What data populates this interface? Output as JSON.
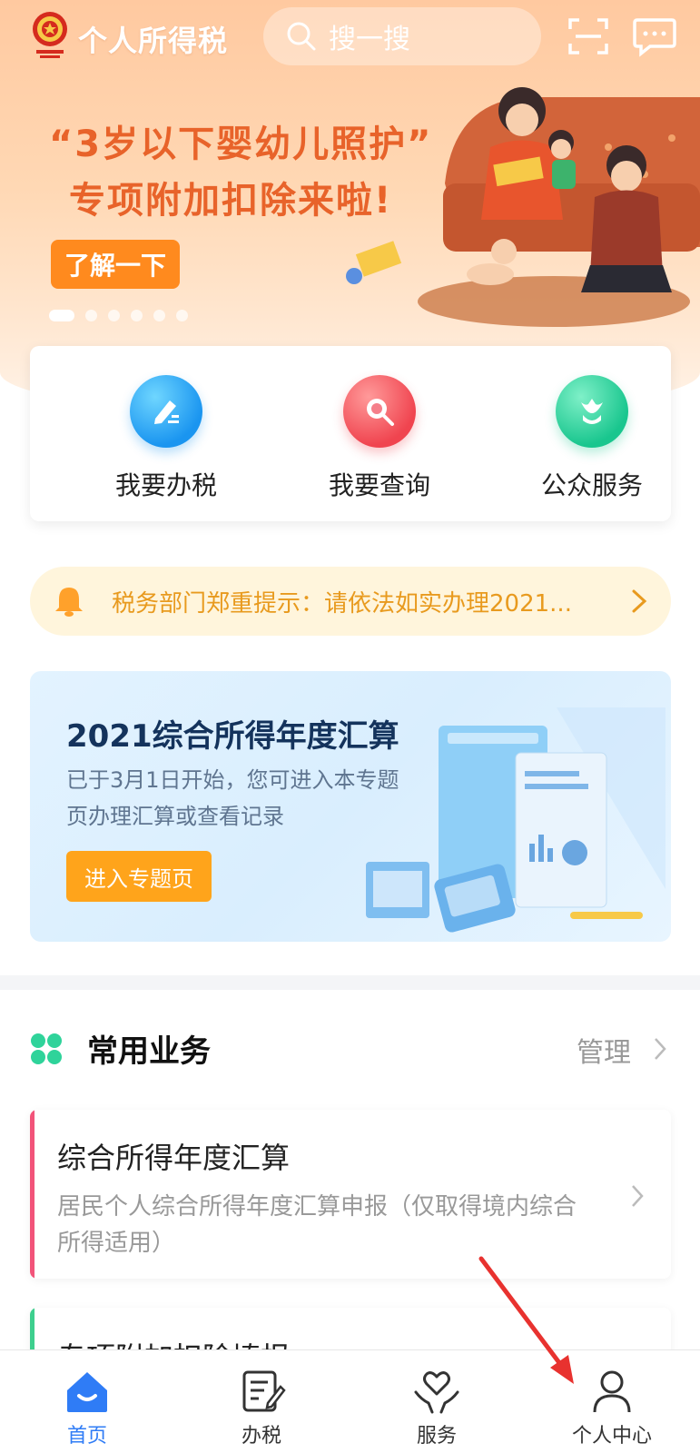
{
  "header": {
    "app_title": "个人所得税",
    "search_placeholder": "搜一搜"
  },
  "banner": {
    "line1": "“3岁以下婴幼儿照护”",
    "line2": "专项附加扣除来啦!",
    "button": "了解一下",
    "pages": 6,
    "active_page": 1
  },
  "quick_actions": [
    {
      "label": "我要办税",
      "icon": "edit-icon",
      "color": "#1a95f0"
    },
    {
      "label": "我要查询",
      "icon": "magnifier-icon",
      "color": "#f0444f"
    },
    {
      "label": "公众服务",
      "icon": "tulip-icon",
      "color": "#19c68e"
    }
  ],
  "notice": {
    "text": "税务部门郑重提示：请依法如实办理2021..."
  },
  "annual_card": {
    "title": "2021综合所得年度汇算",
    "desc_line1": "已于3月1日开始，您可进入本专题",
    "desc_line2": "页办理汇算或查看记录",
    "button": "进入专题页"
  },
  "common_business": {
    "title": "常用业务",
    "manage": "管理",
    "items": [
      {
        "title": "综合所得年度汇算",
        "desc_line1": "居民个人综合所得年度汇算申报（仅取得境内综合",
        "desc_line2": "所得适用）"
      },
      {
        "title": "专项附加扣除填报"
      }
    ]
  },
  "tabbar": {
    "items": [
      {
        "label": "首页",
        "icon": "home-icon",
        "active": true
      },
      {
        "label": "办税",
        "icon": "form-icon",
        "active": false
      },
      {
        "label": "服务",
        "icon": "heart-hands-icon",
        "active": false
      },
      {
        "label": "个人中心",
        "icon": "person-icon",
        "active": false
      }
    ]
  },
  "colors": {
    "accent_orange": "#ff8a1e",
    "tab_active": "#2f7cf6",
    "notice_text": "#e89a1e"
  }
}
